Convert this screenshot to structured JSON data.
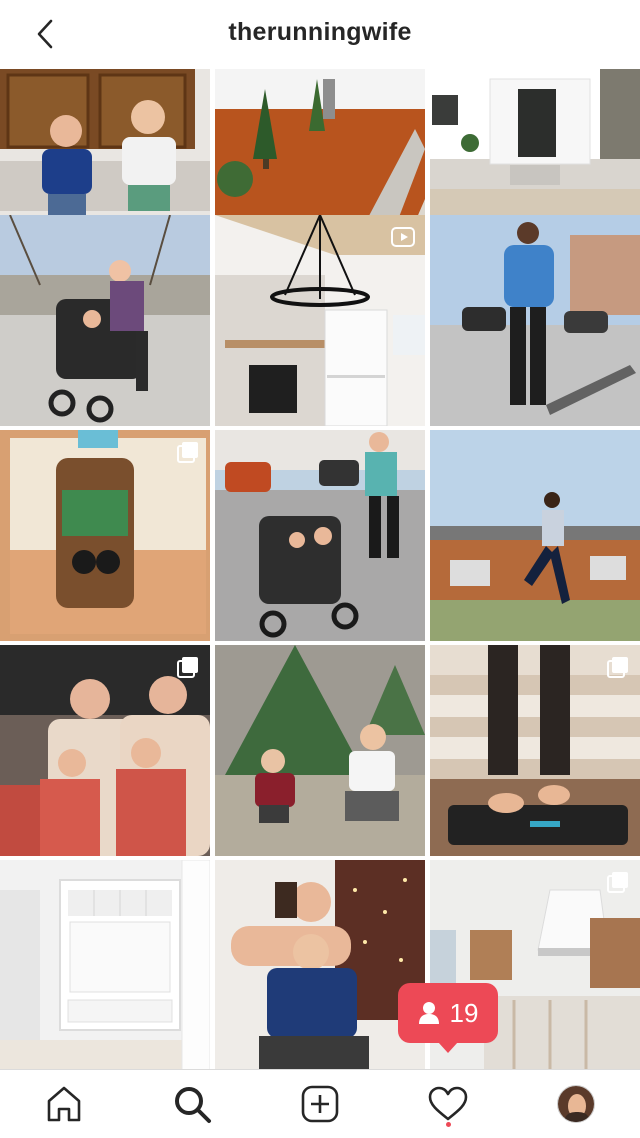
{
  "header": {
    "username": "therunningwife"
  },
  "grid": {
    "posts": [
      {
        "subject": "two toddlers on front steps",
        "multi": false
      },
      {
        "subject": "front walkway with shrubs",
        "multi": false
      },
      {
        "subject": "white house exterior",
        "multi": false
      },
      {
        "subject": "mom pushing double stroller",
        "multi": false
      },
      {
        "subject": "fireplace with chandelier",
        "multi": false,
        "badge": "video-icon"
      },
      {
        "subject": "runner in blue jacket",
        "multi": false
      },
      {
        "subject": "organic bread package",
        "multi": true
      },
      {
        "subject": "jogging with double stroller",
        "multi": false
      },
      {
        "subject": "runner on street",
        "multi": false
      },
      {
        "subject": "family in holiday pajamas",
        "multi": true
      },
      {
        "subject": "kids at christmas tree farm",
        "multi": false
      },
      {
        "subject": "feet on bathroom scale",
        "multi": true
      },
      {
        "subject": "white mudroom built-ins",
        "multi": false
      },
      {
        "subject": "mom and son flexing",
        "multi": false
      },
      {
        "subject": "kitchen under construction",
        "multi": true
      }
    ]
  },
  "notification": {
    "count": "19",
    "icon": "person-icon",
    "color": "#ed4956"
  },
  "tabbar": {
    "items": [
      "home-icon",
      "search-icon",
      "add-post-icon",
      "heart-icon",
      "profile-avatar"
    ]
  }
}
